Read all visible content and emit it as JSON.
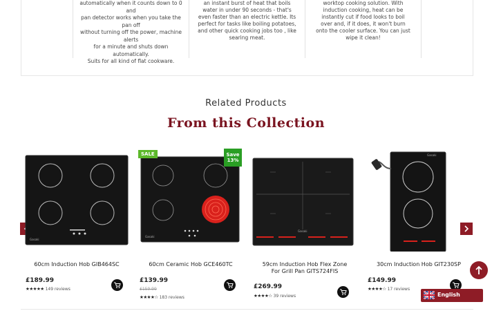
{
  "features": [
    {
      "lines": [
        "automatically when it counts down to 0 and",
        "pan detector works when you take the pan off",
        "without turning off the power, machine alerts",
        "for a minute and shuts down automatically.",
        "Suits for all kind of flat cookware."
      ]
    },
    {
      "lines": [
        "an instant burst of heat that boils",
        "water in under 90 seconds - that's",
        "even faster than an electric kettle. Its",
        "perfect for tasks like boiling potatoes,",
        "and other quick cooking jobs too , like",
        "searing meat."
      ]
    },
    {
      "lines": [
        "worktop cooking solution. With",
        "induction cooking, heat can be",
        "instantly cut if food looks to boil",
        "over and, if it does, it won't burn",
        "onto the cooler surface. You can just",
        "wipe it clean!"
      ]
    }
  ],
  "section": {
    "related_label": "Related Products",
    "collection_label": "From this Collection"
  },
  "products": [
    {
      "name": "60cm Induction Hob GIB464SC",
      "price": "£189.99",
      "old_price": "",
      "stars": "★★★★★",
      "reviews": "149 reviews",
      "badge": ""
    },
    {
      "name": "60cm Ceramic Hob GCE460TC",
      "price": "£139.99",
      "old_price": "£159.99",
      "stars": "★★★★☆",
      "reviews": "183 reviews",
      "badge": "SALE",
      "save_line1": "Save",
      "save_line2": "13%"
    },
    {
      "name_line1": "59cm Induction Hob Flex Zone",
      "name_line2": "For Grill Pan GITS724FIS",
      "price": "£269.99",
      "old_price": "",
      "stars": "★★★★☆",
      "reviews": "39 reviews",
      "badge": ""
    },
    {
      "name": "30cm Induction Hob GIT230SP",
      "price": "£149.99",
      "old_price": "",
      "stars": "★★★★☆",
      "reviews": "17 reviews",
      "badge": ""
    }
  ],
  "language": {
    "label": "English"
  },
  "icons": {
    "prev": "chevron-left-icon",
    "next": "chevron-right-icon",
    "cart": "cart-icon",
    "scroll_top": "arrow-up-icon",
    "flag": "uk-flag-icon"
  },
  "colors": {
    "brand": "#8e1c26",
    "sale": "#5cb82a",
    "save": "#2a9e24"
  }
}
